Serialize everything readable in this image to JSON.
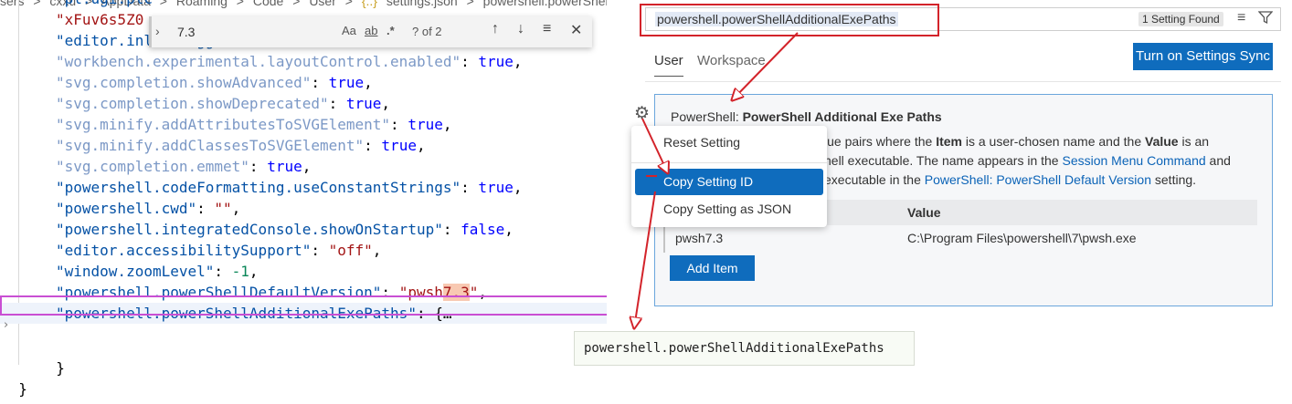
{
  "editor": {
    "breadcrumb": [
      "sers",
      ">",
      "cxxu",
      ">",
      "AppData",
      ">",
      "Roaming",
      ">",
      "Code",
      ">",
      "User",
      ">",
      "{..}",
      "settings.json",
      ">",
      "powershell.powerShellDefau"
    ],
    "lines": [
      {
        "key": "\"pl.ugi.plc",
        "sep": "",
        "val": "",
        "style": "partial"
      },
      {
        "key": "\"xFuv6s5Z0",
        "sep": "",
        "val": "",
        "style": "partial-s"
      },
      {
        "key": "\"editor.inlineSuggest.enabled\"",
        "sep": ": ",
        "val": "true",
        "vt": "b",
        "end": ","
      },
      {
        "key": "\"workbench.experimental.layoutControl.enabled\"",
        "sep": ": ",
        "val": "true",
        "vt": "b",
        "end": ",",
        "dim": true
      },
      {
        "key": "\"svg.completion.showAdvanced\"",
        "sep": ": ",
        "val": "true",
        "vt": "b",
        "end": ",",
        "dim": true
      },
      {
        "key": "\"svg.completion.showDeprecated\"",
        "sep": ": ",
        "val": "true",
        "vt": "b",
        "end": ",",
        "dim": true
      },
      {
        "key": "\"svg.minify.addAttributesToSVGElement\"",
        "sep": ": ",
        "val": "true",
        "vt": "b",
        "end": ",",
        "dim": true
      },
      {
        "key": "\"svg.minify.addClassesToSVGElement\"",
        "sep": ": ",
        "val": "true",
        "vt": "b",
        "end": ",",
        "dim": true
      },
      {
        "key": "\"svg.completion.emmet\"",
        "sep": ": ",
        "val": "true",
        "vt": "b",
        "end": ",",
        "dim": true
      },
      {
        "key": "\"powershell.codeFormatting.useConstantStrings\"",
        "sep": ": ",
        "val": "true",
        "vt": "b",
        "end": ","
      },
      {
        "key": "\"powershell.cwd\"",
        "sep": ": ",
        "val": "\"\"",
        "vt": "s",
        "end": ","
      },
      {
        "key": "\"powershell.integratedConsole.showOnStartup\"",
        "sep": ": ",
        "val": "false",
        "vt": "b",
        "end": ","
      },
      {
        "key": "\"editor.accessibilitySupport\"",
        "sep": ": ",
        "val": "\"off\"",
        "vt": "s",
        "end": ","
      },
      {
        "key": "\"window.zoomLevel\"",
        "sep": ": ",
        "val": "-1",
        "vt": "n",
        "end": ","
      },
      {
        "key": "\"powershell.powerShellDefaultVersion\"",
        "sep": ": ",
        "val": "\"pwsh7.3\"",
        "vt": "s",
        "end": ","
      },
      {
        "key": "\"powershell.powerShellAdditionalExePaths\"",
        "sep": ": ",
        "val": "{…",
        "vt": "p",
        "end": ""
      }
    ],
    "close_brace_inner": "}",
    "close_brace_outer": "}"
  },
  "find": {
    "value": "7.3",
    "opt_case": "Aa",
    "opt_word": "ab",
    "opt_regex": ".*",
    "count": "? of 2"
  },
  "settings": {
    "search_value": "powershell.powerShellAdditionalExePaths",
    "found_badge": "1 Setting Found",
    "tab_user": "User",
    "tab_workspace": "Workspace",
    "sync_button": "Turn on Settings Sync",
    "setting": {
      "category": "PowerShell: ",
      "name": "PowerShell Additional Exe Paths",
      "desc1_a": "lue pairs where the ",
      "desc1_b": "Item",
      "desc1_c": " is a user-chosen name and the ",
      "desc1_d": "Value",
      "desc1_e": " is an",
      "desc2_a": "hell executable. The name appears in the ",
      "desc2_link": "Session Menu Command",
      "desc2_b": " and",
      "desc3_a": "executable in the ",
      "desc3_link": "PowerShell: PowerShell Default Version",
      "desc3_b": " setting.",
      "col_value": "Value",
      "row_item": "pwsh7.3",
      "row_value": "C:\\Program Files\\powershell\\7\\pwsh.exe",
      "add_item": "Add Item"
    }
  },
  "context_menu": {
    "items": [
      "Reset Setting",
      "Copy Setting ID",
      "Copy Setting as JSON"
    ],
    "selected": "Copy Setting ID"
  },
  "tooltip": "powershell.powerShellAdditionalExePaths",
  "colors": {
    "accent": "#0f6cbd",
    "annotation_red": "#d3232a",
    "annotation_magenta": "#c94fd3"
  }
}
